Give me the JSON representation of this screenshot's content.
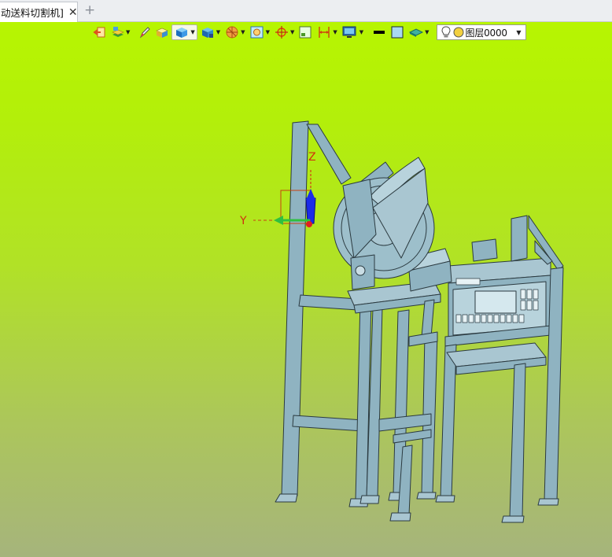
{
  "tab": {
    "title": "动送料切割机]",
    "close_glyph": "✕",
    "add_glyph": "+"
  },
  "toolbar": {
    "items": [
      {
        "name": "exit-sketch-icon"
      },
      {
        "name": "layer-manager-icon",
        "dropdown": true
      },
      {
        "name": "pencil-icon"
      },
      {
        "name": "box-solid-icon"
      },
      {
        "name": "shaded-display-icon",
        "dropdown": true,
        "active": true
      },
      {
        "name": "view-orientation-icon",
        "dropdown": true
      },
      {
        "name": "section-view-icon",
        "dropdown": true
      },
      {
        "name": "zoom-fit-icon",
        "dropdown": true
      },
      {
        "name": "snap-point-icon",
        "dropdown": true
      },
      {
        "name": "frame-view-icon"
      },
      {
        "name": "dimension-icon",
        "dropdown": true
      },
      {
        "name": "monitor-display-icon",
        "dropdown": true
      },
      {
        "name": "line-color-icon"
      },
      {
        "name": "fill-color-icon"
      },
      {
        "name": "material-icon",
        "dropdown": true
      }
    ],
    "layer": {
      "value": "图层0000",
      "arrow": "▼"
    }
  },
  "triad": {
    "y_label": "Y",
    "z_label": "Z"
  },
  "colors": {
    "viewport_top": "#b7f501",
    "viewport_bottom": "#a6b47c",
    "model_fill": "#8fb3c1",
    "model_stroke": "#2b3a40",
    "axis_x": "#e03020",
    "axis_y": "#2fc040",
    "axis_z": "#2030e0"
  }
}
